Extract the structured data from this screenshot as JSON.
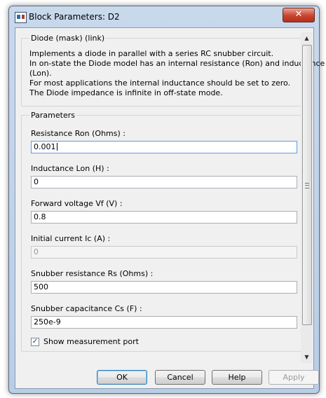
{
  "window": {
    "title": "Block Parameters: D2",
    "close_glyph": "✕"
  },
  "description": {
    "group_title": "Diode (mask) (link)",
    "lines": [
      "Implements a diode in parallel with a series RC snubber circuit.",
      "In on-state the Diode model has an internal resistance (Ron) and inductance",
      "(Lon).",
      "For most applications the internal inductance should be set to zero.",
      "The Diode impedance is infinite in off-state mode."
    ]
  },
  "parameters": {
    "group_title": "Parameters",
    "fields": [
      {
        "label": "Resistance Ron (Ohms) :",
        "value": "0.001"
      },
      {
        "label": "Inductance Lon (H) :",
        "value": "0"
      },
      {
        "label": "Forward voltage Vf (V) :",
        "value": "0.8"
      },
      {
        "label": "Initial current Ic (A) :",
        "value": "0"
      },
      {
        "label": "Snubber resistance Rs (Ohms) :",
        "value": "500"
      },
      {
        "label": "Snubber capacitance Cs (F) :",
        "value": "250e-9"
      }
    ],
    "checkbox": {
      "label": "Show measurement port",
      "checked": true,
      "check_glyph": "✓"
    }
  },
  "buttons": {
    "ok": "OK",
    "cancel": "Cancel",
    "help": "Help",
    "apply": "Apply"
  },
  "scrollbar": {
    "up_glyph": "▲",
    "down_glyph": "▼"
  }
}
